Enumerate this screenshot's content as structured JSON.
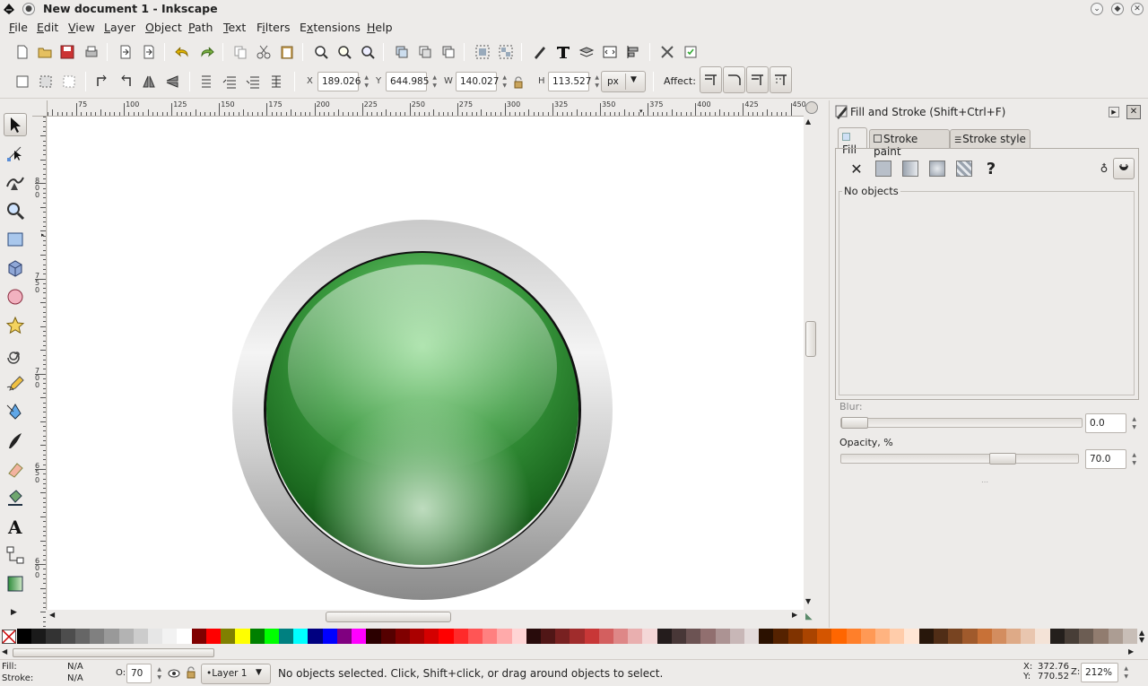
{
  "window": {
    "title": "New document 1 - Inkscape"
  },
  "menu": [
    {
      "pre": "",
      "u": "F",
      "post": "ile"
    },
    {
      "pre": "",
      "u": "E",
      "post": "dit"
    },
    {
      "pre": "",
      "u": "V",
      "post": "iew"
    },
    {
      "pre": "",
      "u": "L",
      "post": "ayer"
    },
    {
      "pre": "",
      "u": "O",
      "post": "bject"
    },
    {
      "pre": "",
      "u": "P",
      "post": "ath"
    },
    {
      "pre": "",
      "u": "T",
      "post": "ext"
    },
    {
      "pre": "F",
      "u": "i",
      "post": "lters"
    },
    {
      "pre": "E",
      "u": "x",
      "post": "tensions"
    },
    {
      "pre": "",
      "u": "H",
      "post": "elp"
    }
  ],
  "toolbar": {
    "x_label": "X",
    "x_value": "189.026",
    "y_label": "Y",
    "y_value": "644.985",
    "w_label": "W",
    "w_value": "140.027",
    "h_label": "H",
    "h_value": "113.527",
    "unit": "px",
    "affect_label": "Affect:"
  },
  "ruler": {
    "h_ticks": [
      "75",
      "100",
      "125",
      "150",
      "175",
      "200",
      "225",
      "250",
      "275",
      "300",
      "325",
      "350",
      "375",
      "400",
      "425",
      "450"
    ],
    "v_ticks": [
      "8\n0\n0",
      "7\n5\n0",
      "7\n0\n0",
      "6\n5\n0",
      "6\n0\n0"
    ]
  },
  "dock": {
    "title": "Fill and Stroke (Shift+Ctrl+F)",
    "tabs": [
      {
        "label": "Fill"
      },
      {
        "label": "Stroke paint"
      },
      {
        "label": "Stroke style"
      }
    ],
    "no_objects": "No objects",
    "blur_label": "Blur:",
    "blur_value": "0.0",
    "blur_fraction": 0.0,
    "opacity_label": "Opacity, %",
    "opacity_value": "70.0",
    "opacity_fraction": 0.7
  },
  "palette_colors": [
    "#000000",
    "#1a1a1a",
    "#333333",
    "#4d4d4d",
    "#666666",
    "#808080",
    "#999999",
    "#b3b3b3",
    "#cccccc",
    "#e6e6e6",
    "#f2f2f2",
    "#ffffff",
    "#800000",
    "#ff0000",
    "#808000",
    "#ffff00",
    "#008000",
    "#00ff00",
    "#008080",
    "#00ffff",
    "#000080",
    "#0000ff",
    "#800080",
    "#ff00ff",
    "#2b0000",
    "#550000",
    "#800000",
    "#aa0000",
    "#d40000",
    "#ff0000",
    "#ff2a2a",
    "#ff5555",
    "#ff8080",
    "#ffaaaa",
    "#ffd5d5",
    "#280b0b",
    "#501616",
    "#782121",
    "#a02c2c",
    "#c83737",
    "#d35f5f",
    "#de8787",
    "#e9afaf",
    "#f4d7d7",
    "#241c1c",
    "#483737",
    "#6c5353",
    "#916f6f",
    "#ac9393",
    "#c8b7b7",
    "#e3dbdb",
    "#2b1100",
    "#552200",
    "#803300",
    "#aa4400",
    "#d45500",
    "#ff6600",
    "#ff7f2a",
    "#ff9955",
    "#ffb380",
    "#ffccaa",
    "#ffe6d5",
    "#28170b",
    "#502d16",
    "#784421",
    "#a05a2c",
    "#c87137",
    "#d38d5f",
    "#deaa87",
    "#e9c6af",
    "#f4e3d7",
    "#241f1c",
    "#483e37",
    "#6c5d53",
    "#917c6f",
    "#ac9d93",
    "#c8beb7"
  ],
  "status": {
    "fill_label": "Fill:",
    "fill_value": "N/A",
    "stroke_label": "Stroke:",
    "stroke_value": "N/A",
    "opacity_prefix": "O:",
    "opacity_value": "70",
    "layer": "•Layer 1",
    "message": "No objects selected. Click, Shift+click, or drag around objects to select.",
    "x_label": "X:",
    "x_value": "372.76",
    "y_label": "Y:",
    "y_value": "770.52",
    "zoom_label": "Z:",
    "zoom_value": "212%"
  }
}
